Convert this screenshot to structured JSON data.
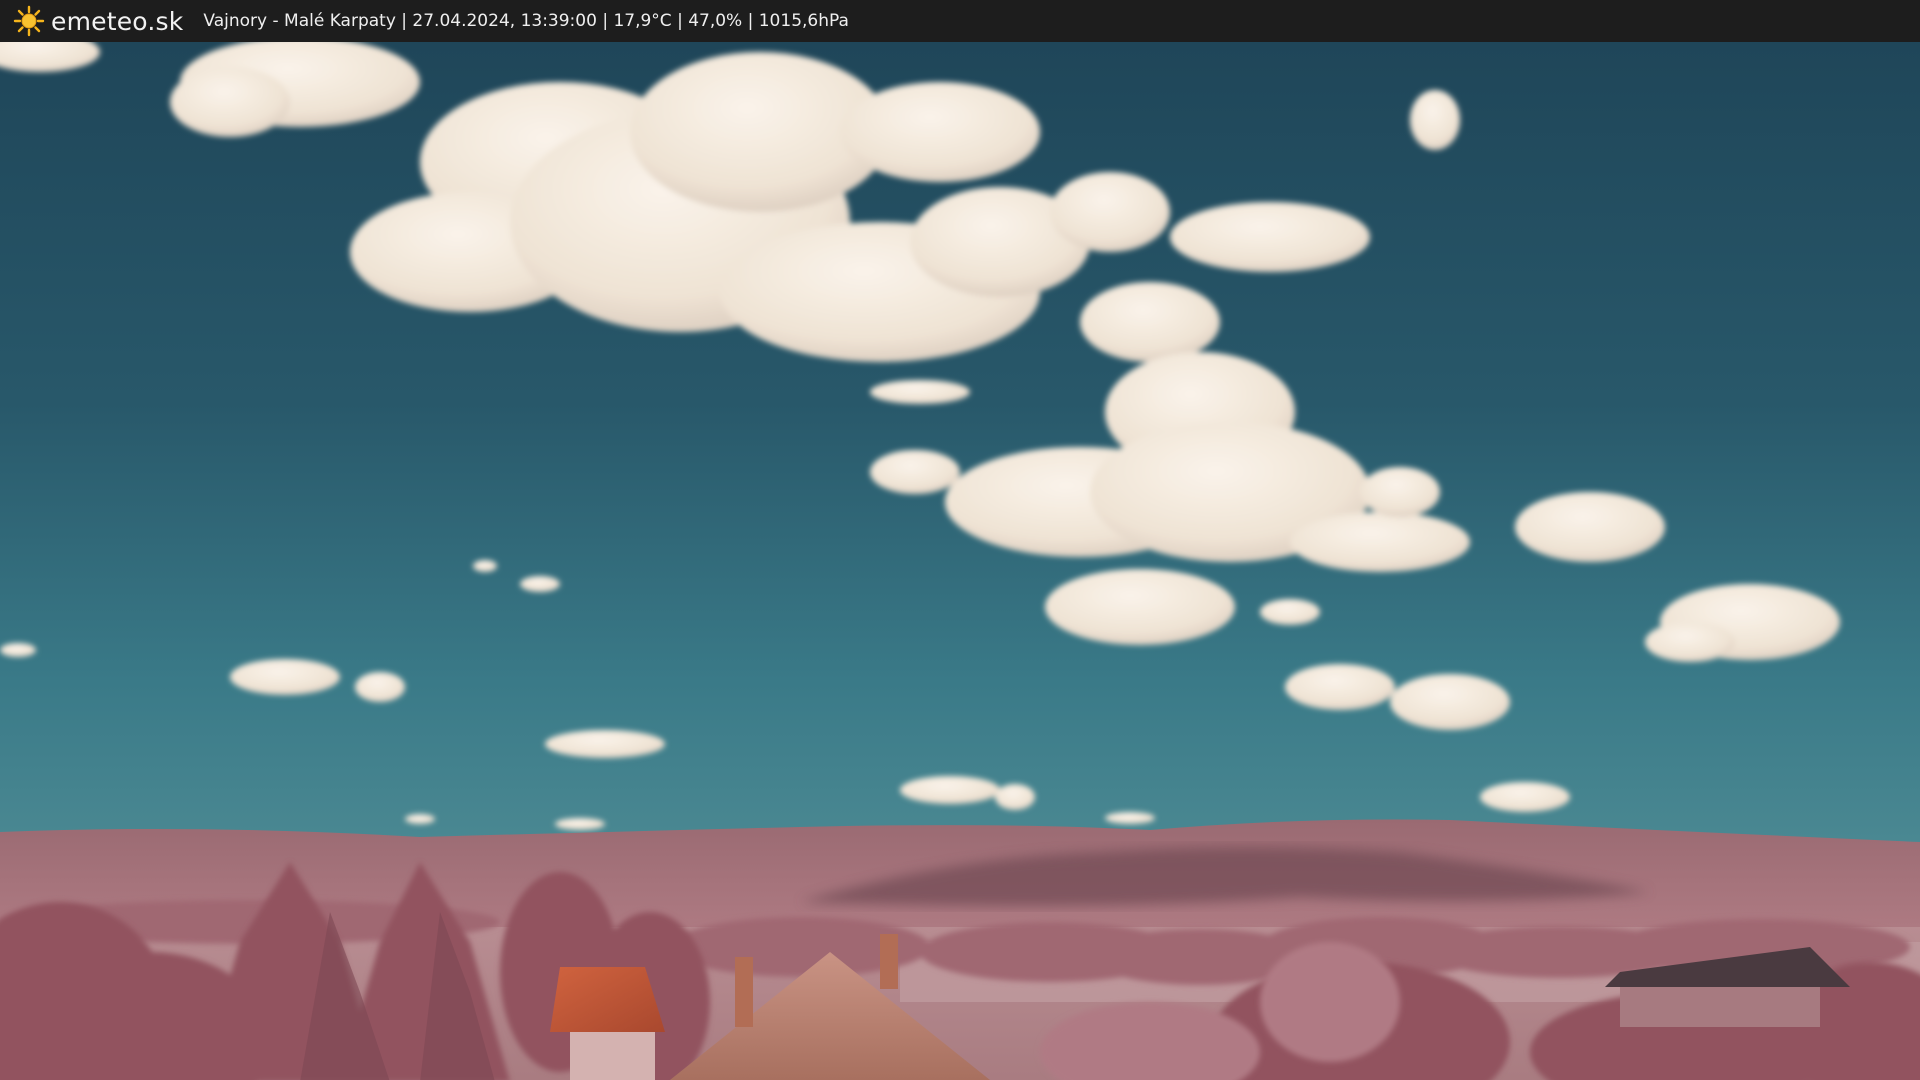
{
  "header": {
    "brand": "emeteo.sk",
    "logo_icon": "sun-icon",
    "caption": "Vajnory - Malé Karpaty | 27.04.2024, 13:39:00 | 17,9°C | 47,0% | 1015,6hPa"
  },
  "colors": {
    "bar_background": "#1d1d1d",
    "sun_yellow": "#f6b51c",
    "sky_top": "#1f4a5c",
    "sky_bottom": "#3a7a8a",
    "cloud": "#f1e8dc",
    "foliage": "#a86a76",
    "roof": "#c45a3a"
  }
}
